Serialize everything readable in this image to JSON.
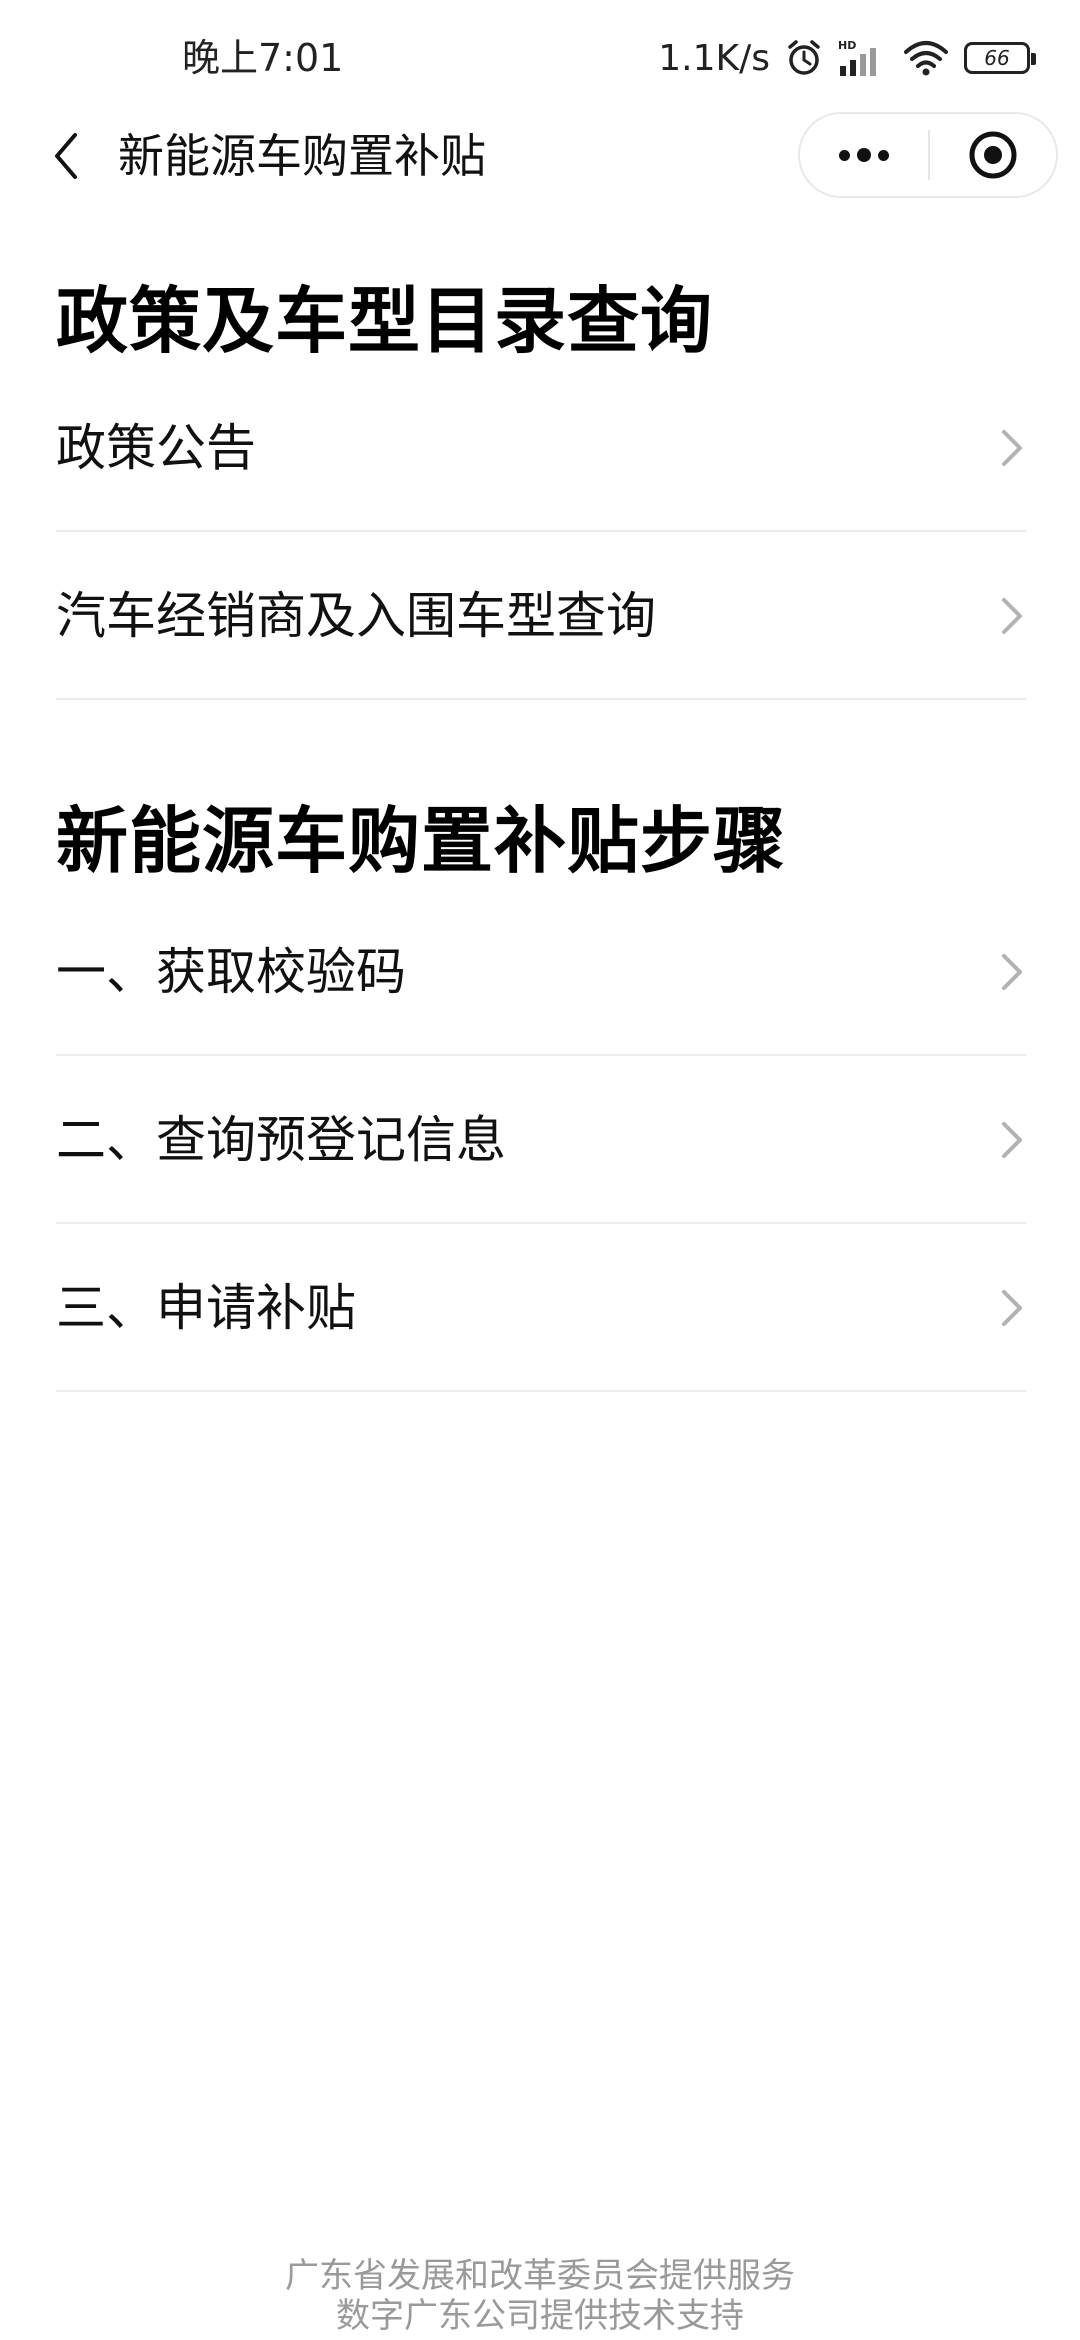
{
  "status_bar": {
    "time": "晚上7:01",
    "net_speed": "1.1K/s",
    "battery_level": "66",
    "icons": [
      "alarm-icon",
      "hd-signal-icon",
      "wifi-icon",
      "battery-icon"
    ]
  },
  "nav": {
    "title": "新能源车购置补贴",
    "icons": [
      "back-icon",
      "more-icon",
      "close-target-icon"
    ]
  },
  "sections": [
    {
      "title": "政策及车型目录查询",
      "items": [
        {
          "label": "政策公告"
        },
        {
          "label": "汽车经销商及入围车型查询"
        }
      ]
    },
    {
      "title": "新能源车购置补贴步骤",
      "items": [
        {
          "label": "一、获取校验码"
        },
        {
          "label": "二、查询预登记信息"
        },
        {
          "label": "三、申请补贴"
        }
      ]
    }
  ],
  "footer": {
    "line1": "广东省发展和改革委员会提供服务",
    "line2": "数字广东公司提供技术支持"
  },
  "colors": {
    "text": "#111111",
    "divider": "#ececec",
    "chevron": "#b3b3b3",
    "footer_text": "#9a9a9a"
  }
}
